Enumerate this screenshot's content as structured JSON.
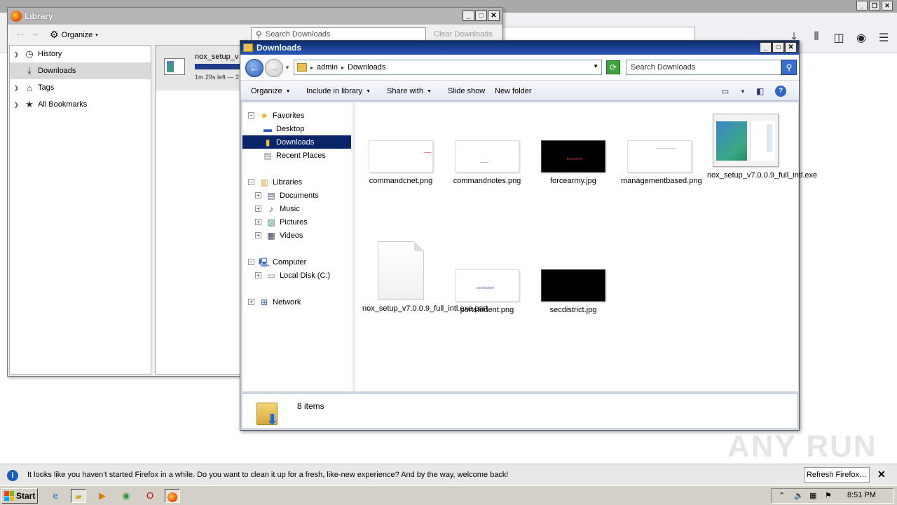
{
  "firefox": {
    "toolbar_icons": [
      "download-icon",
      "library-icon",
      "sidebar-icon",
      "account-icon",
      "menu-icon"
    ]
  },
  "library": {
    "title": "Library",
    "organize_label": "Organize",
    "search_placeholder": "Search Downloads",
    "clear_label": "Clear Downloads",
    "sidebar": [
      {
        "label": "History",
        "icon": "clock-icon",
        "selected": false,
        "expandable": true
      },
      {
        "label": "Downloads",
        "icon": "download-icon",
        "selected": true,
        "expandable": false
      },
      {
        "label": "Tags",
        "icon": "tag-icon",
        "selected": false,
        "expandable": true
      },
      {
        "label": "All Bookmarks",
        "icon": "star-icon",
        "selected": false,
        "expandable": true
      }
    ],
    "download": {
      "name": "nox_setup_v",
      "status": "1m 29s left — 2"
    }
  },
  "explorer": {
    "title": "Downloads",
    "breadcrumb": [
      "admin",
      "Downloads"
    ],
    "search_placeholder": "Search Downloads",
    "commands": {
      "organize": "Organize",
      "include": "Include in library",
      "share": "Share with",
      "slideshow": "Slide show",
      "newfolder": "New folder"
    },
    "tree": {
      "favorites": "Favorites",
      "desktop": "Desktop",
      "downloads": "Downloads",
      "recent": "Recent Places",
      "libraries": "Libraries",
      "documents": "Documents",
      "music": "Music",
      "pictures": "Pictures",
      "videos": "Videos",
      "computer": "Computer",
      "localdisk": "Local Disk (C:)",
      "network": "Network"
    },
    "files": [
      {
        "name": "commandcnet.png",
        "kind": "white-png"
      },
      {
        "name": "commandnotes.png",
        "kind": "white-png"
      },
      {
        "name": "forcearmy.jpg",
        "kind": "black-jpg",
        "overlay": "forcearmy"
      },
      {
        "name": "managementbased.png",
        "kind": "white-png"
      },
      {
        "name": "nox_setup_v7.0.0.9_full_intl.exe",
        "kind": "exe"
      },
      {
        "name": "nox_setup_v7.0.0.9_full_intl.exe.part",
        "kind": "blank-doc"
      },
      {
        "name": "portstudent.png",
        "kind": "white-png",
        "overlay": "portstudent"
      },
      {
        "name": "secdistrict.jpg",
        "kind": "black-jpg"
      }
    ],
    "status": "8 items"
  },
  "notification": {
    "text": "It looks like you haven’t started Firefox in a while. Do you want to clean it up for a fresh, like-new experience? And by the way, welcome back!",
    "button": "Refresh Firefox…"
  },
  "watermark": "ANY RUN",
  "taskbar": {
    "start": "Start",
    "clock": "8:51 PM"
  }
}
